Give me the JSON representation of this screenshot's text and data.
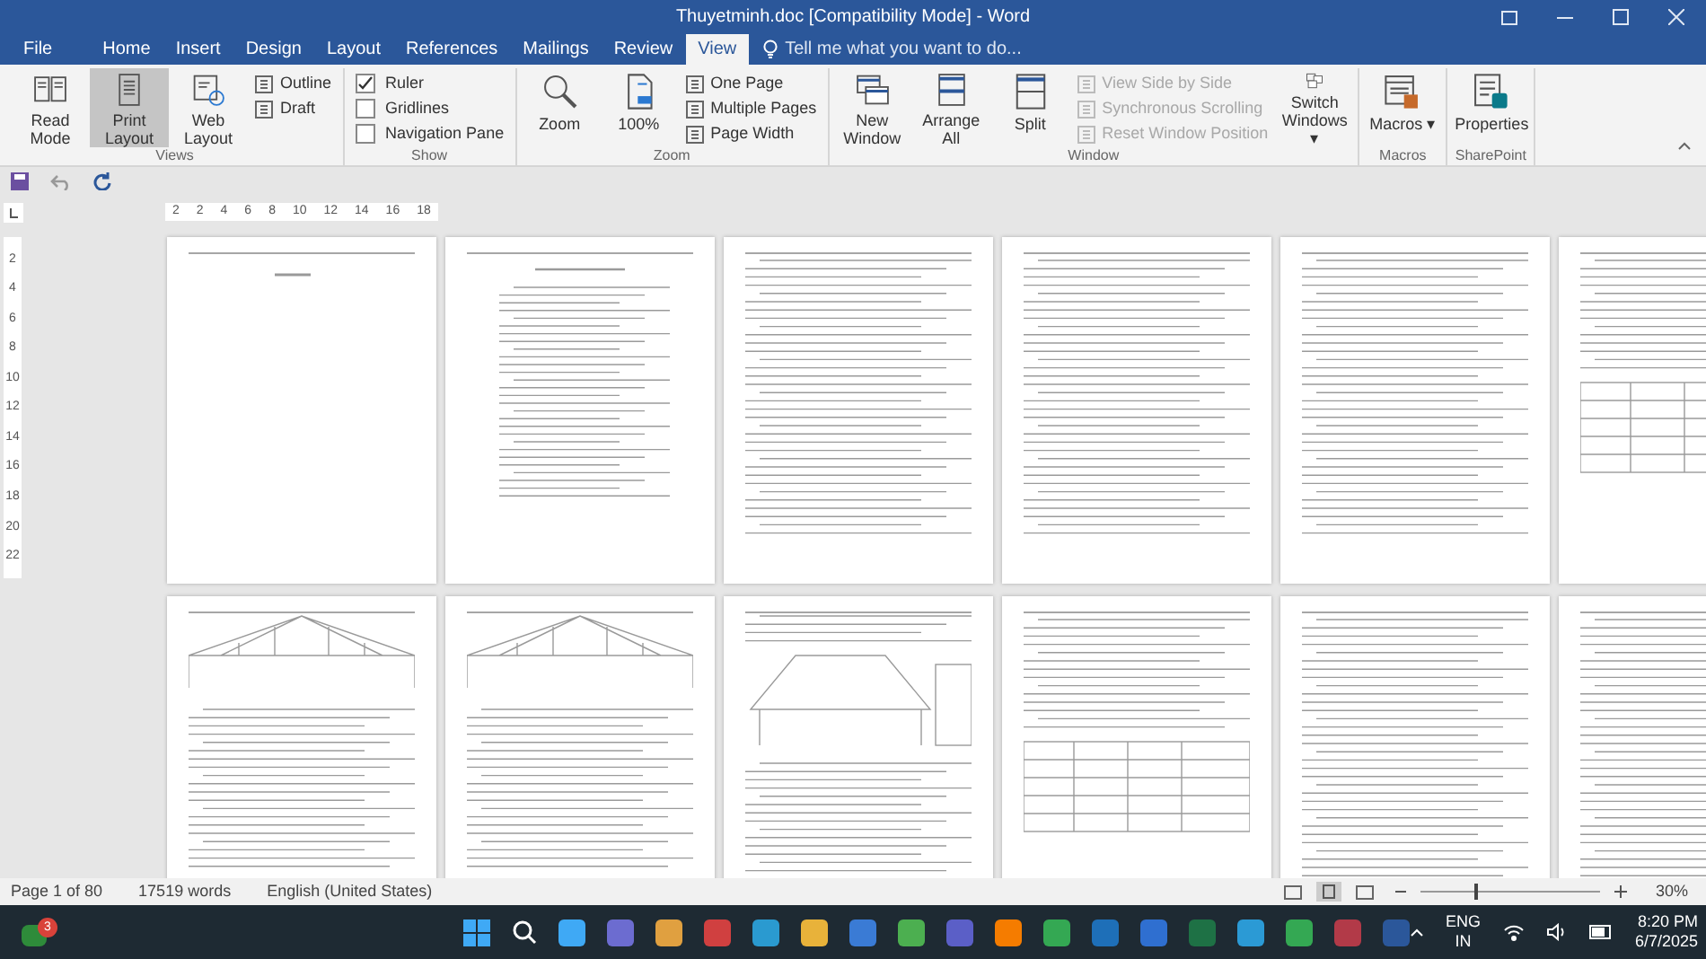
{
  "window": {
    "title": "Thuyetminh.doc [Compatibility Mode] - Word"
  },
  "tabs": [
    {
      "label": "File",
      "selected": false
    },
    {
      "label": "Home",
      "selected": false
    },
    {
      "label": "Insert",
      "selected": false
    },
    {
      "label": "Design",
      "selected": false
    },
    {
      "label": "Layout",
      "selected": false
    },
    {
      "label": "References",
      "selected": false
    },
    {
      "label": "Mailings",
      "selected": false
    },
    {
      "label": "Review",
      "selected": false
    },
    {
      "label": "View",
      "selected": true
    }
  ],
  "tell_me": {
    "placeholder": "Tell me what you want to do..."
  },
  "ribbon": {
    "groups": [
      {
        "name": "Views",
        "items": [
          {
            "kind": "large",
            "label": "Read Mode",
            "selected": false
          },
          {
            "kind": "large",
            "label": "Print Layout",
            "selected": true
          },
          {
            "kind": "large",
            "label": "Web Layout",
            "selected": false
          },
          {
            "kind": "small",
            "label": "Outline",
            "disabled": false
          },
          {
            "kind": "small",
            "label": "Draft",
            "disabled": false
          }
        ]
      },
      {
        "name": "Show",
        "items": [
          {
            "kind": "check",
            "label": "Ruler",
            "checked": true
          },
          {
            "kind": "check",
            "label": "Gridlines",
            "checked": false
          },
          {
            "kind": "check",
            "label": "Navigation Pane",
            "checked": false
          }
        ]
      },
      {
        "name": "Zoom",
        "items": [
          {
            "kind": "large",
            "label": "Zoom",
            "selected": false
          },
          {
            "kind": "large",
            "label": "100%",
            "selected": false
          },
          {
            "kind": "small",
            "label": "One Page",
            "disabled": false
          },
          {
            "kind": "small",
            "label": "Multiple Pages",
            "disabled": false
          },
          {
            "kind": "small",
            "label": "Page Width",
            "disabled": false
          }
        ]
      },
      {
        "name": "Window",
        "items": [
          {
            "kind": "large",
            "label": "New Window",
            "selected": false
          },
          {
            "kind": "large",
            "label": "Arrange All",
            "selected": false
          },
          {
            "kind": "large",
            "label": "Split",
            "selected": false
          },
          {
            "kind": "small",
            "label": "View Side by Side",
            "disabled": true
          },
          {
            "kind": "small",
            "label": "Synchronous Scrolling",
            "disabled": true
          },
          {
            "kind": "small",
            "label": "Reset Window Position",
            "disabled": true
          },
          {
            "kind": "large",
            "label": "Switch Windows ▾",
            "selected": false
          }
        ]
      },
      {
        "name": "Macros",
        "items": [
          {
            "kind": "large",
            "label": "Macros ▾",
            "selected": false
          }
        ]
      },
      {
        "name": "SharePoint",
        "items": [
          {
            "kind": "large",
            "label": "Properties",
            "selected": false
          }
        ]
      }
    ]
  },
  "ruler": {
    "marks": [
      "2",
      "2",
      "4",
      "6",
      "8",
      "10",
      "12",
      "14",
      "16",
      "18"
    ],
    "vertical_marks": [
      "2",
      "4",
      "6",
      "8",
      "10",
      "12",
      "14",
      "16",
      "18",
      "20",
      "22"
    ]
  },
  "pages": [
    {
      "kind": "title"
    },
    {
      "kind": "ruled"
    },
    {
      "kind": "text"
    },
    {
      "kind": "text"
    },
    {
      "kind": "text"
    },
    {
      "kind": "table"
    },
    {
      "kind": "truss"
    },
    {
      "kind": "truss"
    },
    {
      "kind": "frame"
    },
    {
      "kind": "table"
    },
    {
      "kind": "text"
    },
    {
      "kind": "text"
    }
  ],
  "status_bar": {
    "page": "Page 1 of 80",
    "words": "17519 words",
    "language": "English (United States)",
    "zoom": "30%",
    "level": 0.3
  },
  "taskbar": {
    "badge": "3",
    "lang": "ENG",
    "region": "IN",
    "time": "8:20 PM",
    "date": "6/7/2025"
  }
}
